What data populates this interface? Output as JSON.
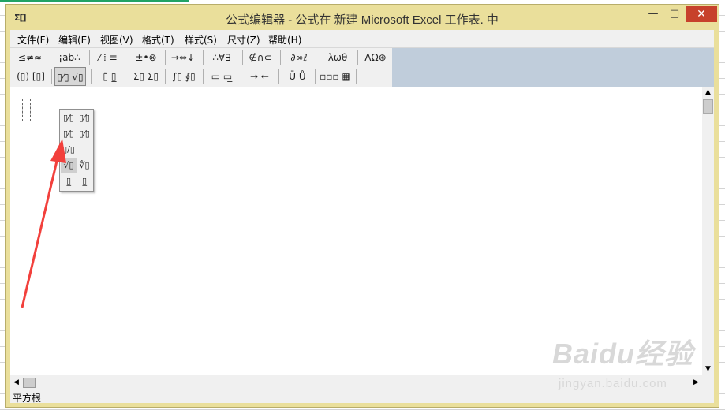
{
  "window": {
    "icon_text": "Σ[]",
    "title": "公式编辑器 - 公式在 新建 Microsoft Excel 工作表. 中"
  },
  "controls": {
    "minimize": "—",
    "maximize": "□",
    "close": "✕"
  },
  "menu": [
    "文件(F)",
    "编辑(E)",
    "视图(V)",
    "格式(T)",
    "样式(S)",
    "尺寸(Z)",
    "帮助(H)"
  ],
  "toolbar_row1": [
    "≤≠≈",
    "¡ab∴",
    "⁄ ⁞ ≡",
    "±•⊗",
    "→⇔↓",
    "∴∀∃",
    "∉∩⊂",
    "∂∞ℓ",
    "λωθ",
    "ΛΩ⊛"
  ],
  "toolbar_row2": [
    "(▯) [▯]",
    "▯⁄▯ √▯",
    "▯̈ ▯̲",
    "Σ▯ Σ▯",
    "∫▯ ∮▯",
    "▭ ▭̲",
    "→ ←",
    "Ū Ů",
    "▫▫▫ ▦"
  ],
  "dropdown": [
    "▯⁄▯",
    "▯⁄▯",
    "▯⁄▯",
    "▯⁄▯",
    "▯/▯",
    "√▯",
    "∜▯",
    "▯̲",
    "▯̲"
  ],
  "status": "平方根",
  "watermark": {
    "logo": "Baidu经验",
    "url": "jingyan.baidu.com"
  },
  "colors": {
    "title_bar": "#eadf9b",
    "close_button": "#c7412b",
    "toolbar_fill": "#c0cddb",
    "arrow": "#f2403c"
  }
}
